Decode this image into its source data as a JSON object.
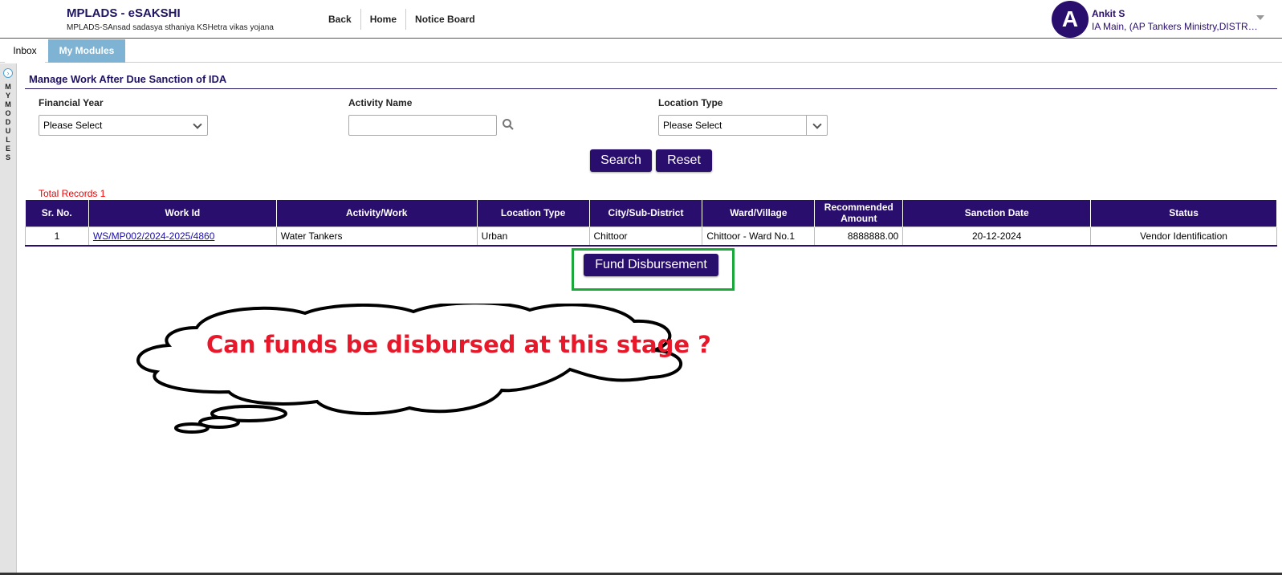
{
  "header": {
    "app_title": "MPLADS - eSAKSHI",
    "app_subtitle": "MPLADS-SAnsad sadasya sthaniya KSHetra vikas yojana",
    "nav": [
      "Back",
      "Home",
      "Notice Board"
    ],
    "user": {
      "avatar_letter": "A",
      "name": "Ankit S",
      "role": "IA Main, (AP Tankers Ministry,DISTRICT...)"
    }
  },
  "tabs": {
    "inbox": "Inbox",
    "my_modules": "My Modules"
  },
  "side_strip": {
    "letters": [
      "M",
      "Y",
      "",
      "M",
      "O",
      "D",
      "U",
      "L",
      "E",
      "S"
    ]
  },
  "page": {
    "title": "Manage Work After Due Sanction of IDA"
  },
  "filters": {
    "financial_year": {
      "label": "Financial Year",
      "value": "Please Select"
    },
    "activity_name": {
      "label": "Activity Name",
      "value": ""
    },
    "location_type": {
      "label": "Location Type",
      "value": "Please Select"
    }
  },
  "buttons": {
    "search": "Search",
    "reset": "Reset",
    "fund_disbursement": "Fund Disbursement"
  },
  "results": {
    "total_records_label": "Total Records",
    "total_records_count": "1",
    "columns": [
      "Sr. No.",
      "Work Id",
      "Activity/Work",
      "Location Type",
      "City/Sub-District",
      "Ward/Village",
      "Recommended Amount",
      "Sanction Date",
      "Status"
    ],
    "rows": [
      {
        "sr_no": "1",
        "work_id": "WS/MP002/2024-2025/4860",
        "activity": "Water Tankers",
        "location_type": "Urban",
        "city": "Chittoor",
        "ward": "Chittoor - Ward No.1",
        "amount": "8888888.00",
        "sanction_date": "20-12-2024",
        "status": "Vendor Identification"
      }
    ]
  },
  "annotation": {
    "cloud_text": "Can funds be disbursed at this stage ?",
    "highlight_color": "#1aa83a",
    "text_color": "#e8182a"
  },
  "colors": {
    "primary": "#2a0e6e",
    "tab_active": "#7fb3d3"
  }
}
